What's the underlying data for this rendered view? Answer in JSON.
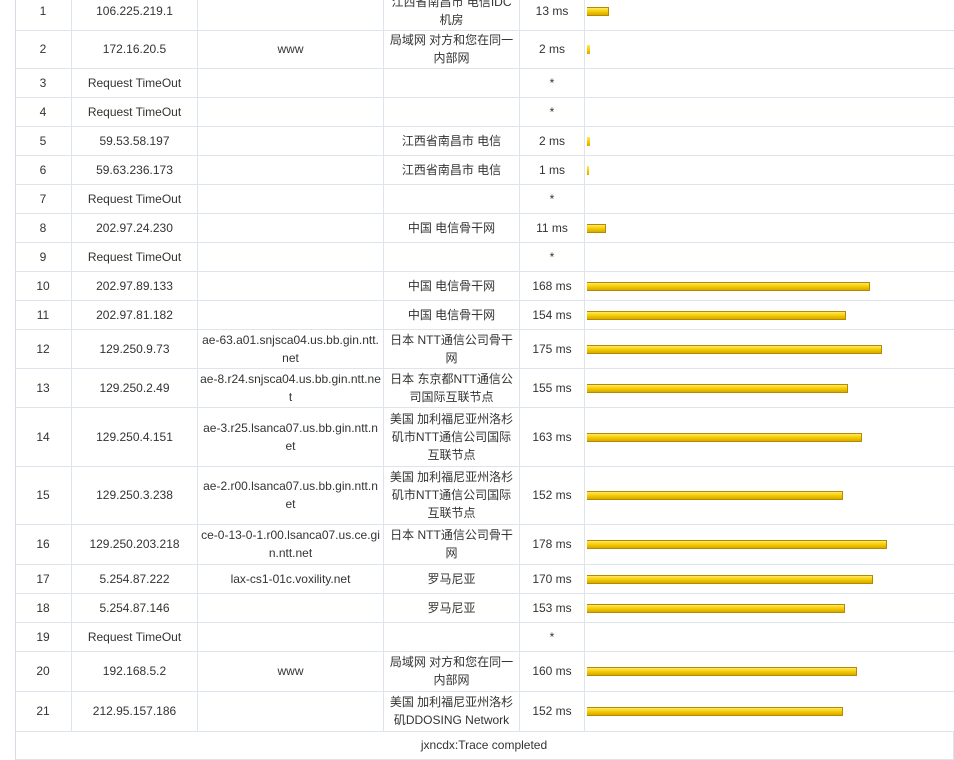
{
  "colors": {
    "bar": "#f5cd00",
    "grid": "#dde4ec"
  },
  "rows": [
    {
      "hop": "1",
      "ip": "106.225.219.1",
      "host": "",
      "loc": "江西省南昌市 电信IDC机房",
      "time": "13 ms",
      "ms": 13
    },
    {
      "hop": "2",
      "ip": "172.16.20.5",
      "host": "www",
      "loc": "局域网 对方和您在同一内部网",
      "time": "2 ms",
      "ms": 2
    },
    {
      "hop": "3",
      "ip": "Request TimeOut",
      "host": "",
      "loc": "",
      "time": "*",
      "ms": null
    },
    {
      "hop": "4",
      "ip": "Request TimeOut",
      "host": "",
      "loc": "",
      "time": "*",
      "ms": null
    },
    {
      "hop": "5",
      "ip": "59.53.58.197",
      "host": "",
      "loc": "江西省南昌市 电信",
      "time": "2 ms",
      "ms": 2
    },
    {
      "hop": "6",
      "ip": "59.63.236.173",
      "host": "",
      "loc": "江西省南昌市 电信",
      "time": "1 ms",
      "ms": 1
    },
    {
      "hop": "7",
      "ip": "Request TimeOut",
      "host": "",
      "loc": "",
      "time": "*",
      "ms": null
    },
    {
      "hop": "8",
      "ip": "202.97.24.230",
      "host": "",
      "loc": "中国 电信骨干网",
      "time": "11 ms",
      "ms": 11
    },
    {
      "hop": "9",
      "ip": "Request TimeOut",
      "host": "",
      "loc": "",
      "time": "*",
      "ms": null
    },
    {
      "hop": "10",
      "ip": "202.97.89.133",
      "host": "",
      "loc": "中国 电信骨干网",
      "time": "168 ms",
      "ms": 168
    },
    {
      "hop": "11",
      "ip": "202.97.81.182",
      "host": "",
      "loc": "中国 电信骨干网",
      "time": "154 ms",
      "ms": 154
    },
    {
      "hop": "12",
      "ip": "129.250.9.73",
      "host": "ae-63.a01.snjsca04.us.bb.gin.ntt.net",
      "loc": "日本 NTT通信公司骨干网",
      "time": "175 ms",
      "ms": 175
    },
    {
      "hop": "13",
      "ip": "129.250.2.49",
      "host": "ae-8.r24.snjsca04.us.bb.gin.ntt.net",
      "loc": "日本 东京都NTT通信公司国际互联节点",
      "time": "155 ms",
      "ms": 155
    },
    {
      "hop": "14",
      "ip": "129.250.4.151",
      "host": "ae-3.r25.lsanca07.us.bb.gin.ntt.net",
      "loc": "美国 加利福尼亚州洛杉矶市NTT通信公司国际互联节点",
      "time": "163 ms",
      "ms": 163
    },
    {
      "hop": "15",
      "ip": "129.250.3.238",
      "host": "ae-2.r00.lsanca07.us.bb.gin.ntt.net",
      "loc": "美国 加利福尼亚州洛杉矶市NTT通信公司国际互联节点",
      "time": "152 ms",
      "ms": 152
    },
    {
      "hop": "16",
      "ip": "129.250.203.218",
      "host": "ce-0-13-0-1.r00.lsanca07.us.ce.gin.ntt.net",
      "loc": "日本 NTT通信公司骨干网",
      "time": "178 ms",
      "ms": 178
    },
    {
      "hop": "17",
      "ip": "5.254.87.222",
      "host": "lax-cs1-01c.voxility.net",
      "loc": "罗马尼亚",
      "time": "170 ms",
      "ms": 170
    },
    {
      "hop": "18",
      "ip": "5.254.87.146",
      "host": "",
      "loc": "罗马尼亚",
      "time": "153 ms",
      "ms": 153
    },
    {
      "hop": "19",
      "ip": "Request TimeOut",
      "host": "",
      "loc": "",
      "time": "*",
      "ms": null
    },
    {
      "hop": "20",
      "ip": "192.168.5.2",
      "host": "www",
      "loc": "局域网 对方和您在同一内部网",
      "time": "160 ms",
      "ms": 160
    },
    {
      "hop": "21",
      "ip": "212.95.157.186",
      "host": "",
      "loc": "美国 加利福尼亚州洛杉矶DDOSING Network",
      "time": "152 ms",
      "ms": 152
    }
  ],
  "footer": {
    "text": "jxncdx:Trace completed"
  }
}
